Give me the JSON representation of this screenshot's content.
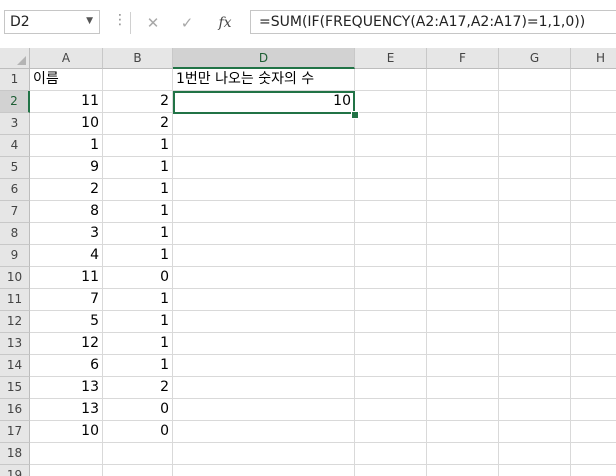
{
  "name_box": {
    "value": "D2"
  },
  "formula_bar": {
    "cancel_glyph": "✕",
    "enter_glyph": "✓",
    "fx_label": "fx",
    "formula": "=SUM(IF(FREQUENCY(A2:A17,A2:A17)=1,1,0))"
  },
  "columns": [
    "A",
    "B",
    "D",
    "E",
    "F",
    "G",
    "H"
  ],
  "selected_column": "D",
  "selected_row": "2",
  "rows": [
    {
      "num": "1",
      "a": "이름",
      "b": "",
      "d": "1번만 나오는 숫자의 수"
    },
    {
      "num": "2",
      "a": "11",
      "b": "2",
      "d": "10"
    },
    {
      "num": "3",
      "a": "10",
      "b": "2",
      "d": ""
    },
    {
      "num": "4",
      "a": "1",
      "b": "1",
      "d": ""
    },
    {
      "num": "5",
      "a": "9",
      "b": "1",
      "d": ""
    },
    {
      "num": "6",
      "a": "2",
      "b": "1",
      "d": ""
    },
    {
      "num": "7",
      "a": "8",
      "b": "1",
      "d": ""
    },
    {
      "num": "8",
      "a": "3",
      "b": "1",
      "d": ""
    },
    {
      "num": "9",
      "a": "4",
      "b": "1",
      "d": ""
    },
    {
      "num": "10",
      "a": "11",
      "b": "0",
      "d": ""
    },
    {
      "num": "11",
      "a": "7",
      "b": "1",
      "d": ""
    },
    {
      "num": "12",
      "a": "5",
      "b": "1",
      "d": ""
    },
    {
      "num": "13",
      "a": "12",
      "b": "1",
      "d": ""
    },
    {
      "num": "14",
      "a": "6",
      "b": "1",
      "d": ""
    },
    {
      "num": "15",
      "a": "13",
      "b": "2",
      "d": ""
    },
    {
      "num": "16",
      "a": "13",
      "b": "0",
      "d": ""
    },
    {
      "num": "17",
      "a": "10",
      "b": "0",
      "d": ""
    },
    {
      "num": "18",
      "a": "",
      "b": "",
      "d": ""
    },
    {
      "num": "19",
      "a": "",
      "b": "",
      "d": ""
    }
  ],
  "colors": {
    "selection": "#217346",
    "header_bg": "#e6e6e6",
    "gridline": "#d9d9d9"
  }
}
